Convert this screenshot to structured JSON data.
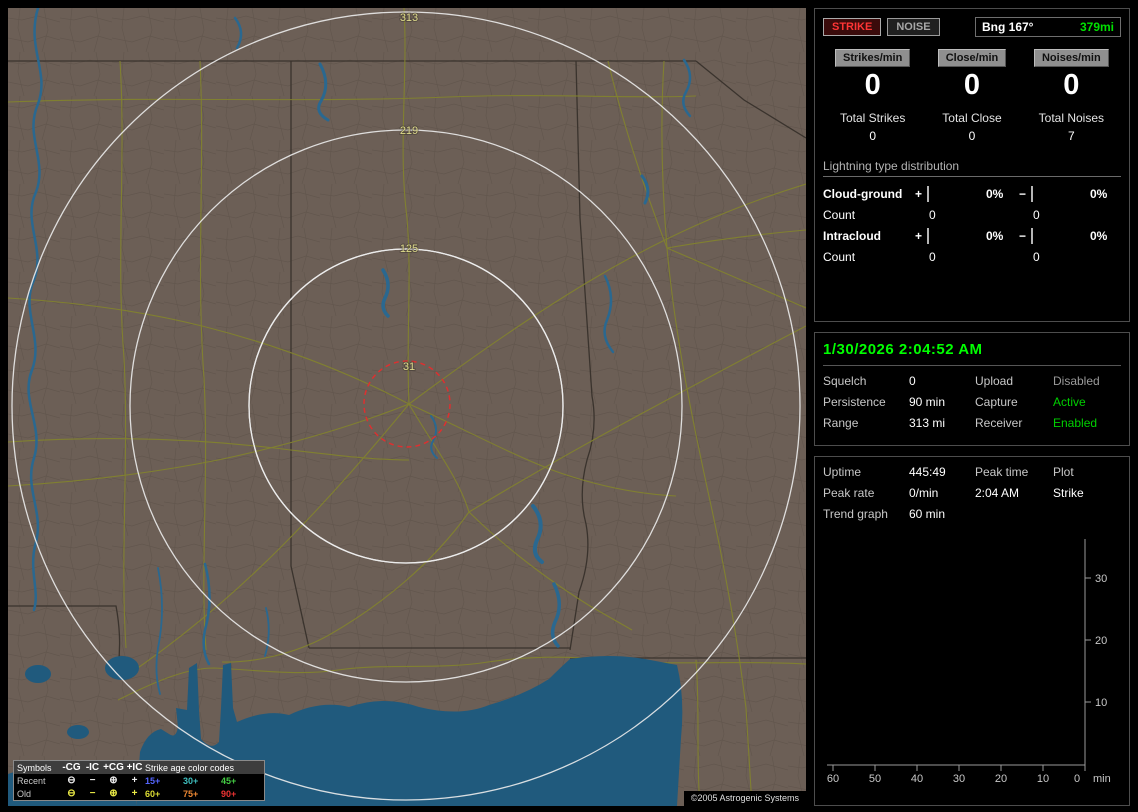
{
  "colors": {
    "strike_red": "#ff3535",
    "status_green": "#00d000",
    "timestamp_green": "#00ff00",
    "bearing_range_green": "#00e000",
    "ring_label_yellow": "#ddd98a",
    "range_ring_white": "#ececec",
    "alarm_circle_red": "#dd3030",
    "map_land": "#6c5f56",
    "map_water": "#205a7d",
    "map_road": "#82822e",
    "age_15_blue": "#5566ff",
    "age_30_cyan": "#3fbfbf",
    "age_45_green": "#44cc44",
    "age_60_yellow": "#dddd33",
    "age_75_orange": "#ee8833",
    "age_90_red": "#ee3333"
  },
  "map": {
    "ring_labels": [
      "313",
      "219",
      "125",
      "31"
    ],
    "copyright": "©2005 Astrogenic Systems",
    "legend": {
      "symbols_header": "Symbols",
      "symbol_cols": [
        "-CG",
        "-IC",
        "+CG",
        "+IC"
      ],
      "age_header": "Strike age color codes",
      "recent_label": "Recent",
      "old_label": "Old",
      "recent_symbols": [
        "⊖",
        "−",
        "⊕",
        "+"
      ],
      "old_symbols": [
        "⊖",
        "−",
        "⊕",
        "+"
      ],
      "recent_ages": [
        "15+",
        "30+",
        "45+"
      ],
      "old_ages": [
        "60+",
        "75+",
        "90+"
      ]
    }
  },
  "panel": {
    "mode_buttons": {
      "strike": "STRIKE",
      "noise": "NOISE"
    },
    "bearing": {
      "label": "Bng 167°",
      "range": "379mi"
    },
    "counters": [
      {
        "label": "Strikes/min",
        "value": "0",
        "total_label": "Total Strikes",
        "total_value": "0"
      },
      {
        "label": "Close/min",
        "value": "0",
        "total_label": "Total Close",
        "total_value": "0"
      },
      {
        "label": "Noises/min",
        "value": "0",
        "total_label": "Total Noises",
        "total_value": "7"
      }
    ],
    "distribution": {
      "title": "Lightning type distribution",
      "plus": "+",
      "minus": "−",
      "count_label": "Count",
      "rows": [
        {
          "label": "Cloud-ground",
          "plus_pct": "0%",
          "minus_pct": "0%",
          "plus_count": "0",
          "minus_count": "0"
        },
        {
          "label": "Intracloud",
          "plus_pct": "0%",
          "minus_pct": "0%",
          "plus_count": "0",
          "minus_count": "0"
        }
      ]
    },
    "status": {
      "timestamp": "1/30/2026 2:04:52 AM",
      "rows": [
        {
          "l1": "Squelch",
          "v1": "0",
          "l2": "Upload",
          "v2": "Disabled"
        },
        {
          "l1": "Persistence",
          "v1": "90 min",
          "l2": "Capture",
          "v2": "Active"
        },
        {
          "l1": "Range",
          "v1": "313 mi",
          "l2": "Receiver",
          "v2": "Enabled"
        }
      ]
    },
    "stats": {
      "rows": [
        {
          "l1": "Uptime",
          "v1": "445:49",
          "l2": "Peak time",
          "v2": "Plot"
        },
        {
          "l1": "Peak rate",
          "v1": "0/min",
          "l2": "2:04 AM",
          "v2": "Strike"
        },
        {
          "l1": "Trend graph",
          "v1": "60 min"
        }
      ]
    },
    "graph": {
      "y_ticks": [
        "30",
        "20",
        "10"
      ],
      "x_ticks": [
        "60",
        "50",
        "40",
        "30",
        "20",
        "10",
        "0"
      ],
      "x_unit": "min"
    }
  }
}
